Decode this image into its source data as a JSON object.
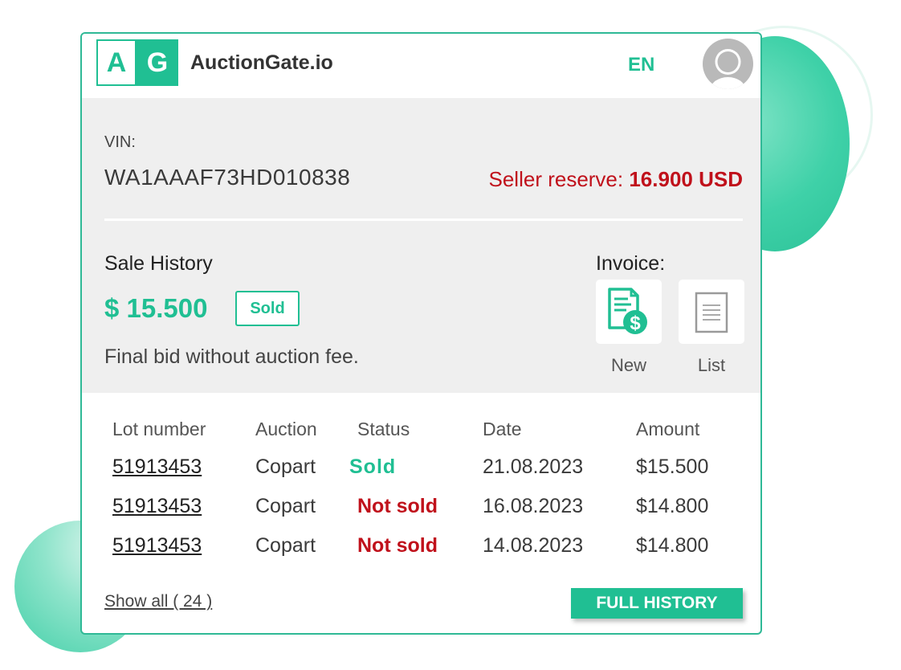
{
  "colors": {
    "accent": "#20bf93",
    "danger": "#c0111b",
    "panel": "#efefef"
  },
  "header": {
    "logo_left": "A",
    "logo_right": "G",
    "brand": "AuctionGate.io",
    "language": "EN",
    "avatar_icon": "user-avatar-icon"
  },
  "vehicle": {
    "vin_label": "VIN:",
    "vin": "WA1AAAF73HD010838",
    "reserve_label": "Seller reserve: ",
    "reserve_value": "16.900 USD"
  },
  "sale_history": {
    "title": "Sale History",
    "price": "$ 15.500",
    "status_badge": "Sold",
    "note": "Final bid without auction fee."
  },
  "invoice": {
    "title": "Invoice:",
    "new_icon": "invoice-dollar-icon",
    "new_label": "New",
    "list_icon": "document-list-icon",
    "list_label": "List"
  },
  "table": {
    "headers": [
      "Lot number",
      "Auction",
      "Status",
      "Date",
      "Amount"
    ],
    "rows": [
      {
        "lot": "51913453",
        "auction": "Copart",
        "status": "Sold",
        "date": "21.08.2023",
        "amount": "$15.500"
      },
      {
        "lot": "51913453",
        "auction": "Copart",
        "status": "Not sold",
        "date": "16.08.2023",
        "amount": "$14.800"
      },
      {
        "lot": "51913453",
        "auction": "Copart",
        "status": "Not sold",
        "date": "14.08.2023",
        "amount": "$14.800"
      }
    ]
  },
  "footer": {
    "show_all": "Show all ( 24 )",
    "full_history": "FULL HISTORY"
  }
}
